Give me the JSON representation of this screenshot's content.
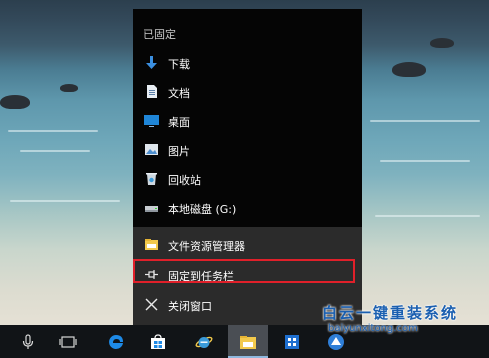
{
  "jumplist": {
    "section_title": "已固定",
    "pinned": [
      {
        "label": "下载",
        "icon": "download-icon"
      },
      {
        "label": "文档",
        "icon": "documents-icon"
      },
      {
        "label": "桌面",
        "icon": "desktop-icon"
      },
      {
        "label": "图片",
        "icon": "pictures-icon"
      },
      {
        "label": "回收站",
        "icon": "recycle-bin-icon"
      },
      {
        "label": "本地磁盘 (G:)",
        "icon": "local-disk-icon"
      }
    ],
    "tasks": [
      {
        "label": "文件资源管理器",
        "icon": "file-explorer-icon"
      },
      {
        "label": "固定到任务栏",
        "icon": "pin-icon"
      },
      {
        "label": "关闭窗口",
        "icon": "close-icon"
      }
    ],
    "highlight_color": "#e0202a"
  },
  "taskbar": {
    "buttons": [
      {
        "name": "microphone-icon"
      },
      {
        "name": "task-view-icon"
      },
      {
        "name": "edge-icon"
      },
      {
        "name": "store-icon"
      },
      {
        "name": "internet-explorer-icon"
      },
      {
        "name": "file-explorer-icon",
        "active": true
      },
      {
        "name": "app-icon"
      },
      {
        "name": "browser-icon"
      }
    ]
  },
  "watermark": {
    "title": "白云一键重装系统",
    "url": "baiyunxitong.com"
  }
}
